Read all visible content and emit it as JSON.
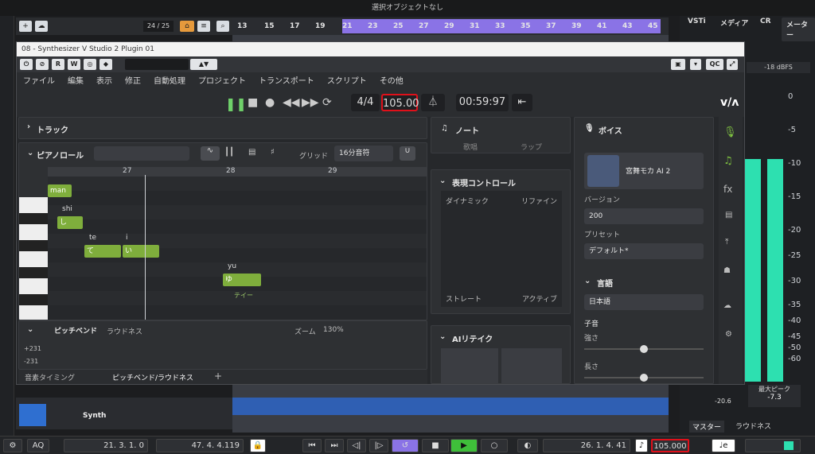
{
  "host": {
    "status_text": "選択オブジェクトなし",
    "track_counter": "24 / 25",
    "ruler_bars": [
      "13",
      "15",
      "17",
      "19",
      "21",
      "23",
      "25",
      "27",
      "29",
      "31",
      "33",
      "35",
      "37",
      "39",
      "41",
      "43",
      "45"
    ],
    "track_name": "Synth",
    "vu_tabs": [
      "VSTi",
      "メディア",
      "CR",
      "メーター"
    ],
    "vu_dbfs": "-18 dBFS",
    "vu_scale": [
      "0",
      "-5",
      "-10",
      "-15",
      "-20",
      "-25",
      "-30",
      "-35",
      "-40",
      "-45",
      "-50",
      "-60"
    ],
    "peak_label": "最大ピーク",
    "peak_value": "-7.3",
    "left_value": "-20.6",
    "bottom_tabs": [
      "マスター",
      "ラウドネス"
    ],
    "transport": {
      "aq": "AQ",
      "left_locator": "21. 3. 1.  0",
      "right_locator": "47. 4. 4.119",
      "position": "26. 1. 4. 41",
      "tempo": "105.000"
    }
  },
  "plugin": {
    "title": "08 - Synthesizer V Studio 2 Plugin 01",
    "tool_buttons": [
      "R",
      "W"
    ],
    "qc": "QC",
    "menu": [
      "ファイル",
      "編集",
      "表示",
      "修正",
      "自動処理",
      "プロジェクト",
      "トランスポート",
      "スクリプト",
      "その他"
    ],
    "time_sig": "4/4",
    "tempo": "105.00",
    "time": "00:59:97",
    "track_label": "トラック",
    "piano_roll": {
      "label": "ピアノロール",
      "grid_label": "グリッド",
      "grid_value": "16分音符",
      "bars": [
        "27",
        "28",
        "29"
      ],
      "region": "man",
      "notes": [
        {
          "lyric": "shi",
          "text": "し"
        },
        {
          "lyric": "te",
          "text": "て"
        },
        {
          "lyric": "i",
          "text": "い"
        },
        {
          "lyric": "yu",
          "text": "ゆ"
        }
      ],
      "sub_note": "テイー"
    },
    "pitch": {
      "label": "ピッチベンド",
      "loudness": "ラウドネス",
      "zoom_label": "ズーム",
      "zoom": "130%",
      "top": "+231",
      "bottom": "-231"
    },
    "tabs": [
      "音素タイミング",
      "ピッチベンド/ラウドネス"
    ],
    "note_panel": {
      "title": "ノート",
      "cols": [
        "歌唱",
        "ラップ"
      ]
    },
    "expression": {
      "title": "表現コントロール",
      "corners": [
        "ダイナミック",
        "リファイン",
        "ストレート",
        "アクティブ"
      ]
    },
    "retake": {
      "title": "AIリテイク"
    },
    "voice": {
      "title": "ボイス",
      "name": "宮舞モカ AI 2",
      "version_label": "バージョン",
      "version": "200",
      "preset_label": "プリセット",
      "preset": "デフォルト*",
      "language_title": "言語",
      "language": "日本語",
      "consonant_title": "子音",
      "strength": "強さ",
      "length": "長さ"
    }
  },
  "colors": {
    "accent": "#8a73e6",
    "note": "#7fae3c",
    "meter": "#2de0b0",
    "highlight": "#e0101a",
    "play": "#3fbf3a"
  }
}
